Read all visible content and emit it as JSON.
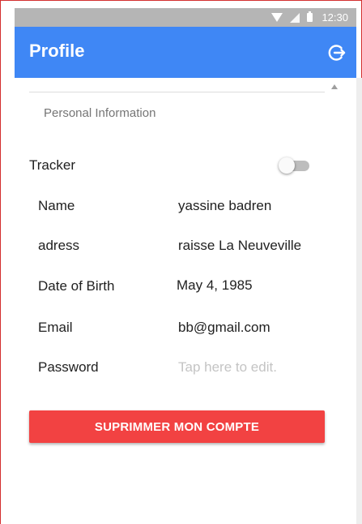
{
  "status_bar": {
    "time": "12:30"
  },
  "app_bar": {
    "title": "Profile"
  },
  "section": {
    "title": "Personal Information"
  },
  "tracker": {
    "label": "Tracker",
    "enabled": false
  },
  "fields": [
    {
      "label": "Name",
      "value": "yassine badren",
      "is_placeholder": false
    },
    {
      "label": "adress",
      "value": "raisse La Neuveville",
      "is_placeholder": false
    },
    {
      "label": "Date of Birth",
      "value": "May 4, 1985",
      "is_placeholder": false
    },
    {
      "label": "Email",
      "value": "bb@gmail.com",
      "is_placeholder": false
    },
    {
      "label": "Password",
      "value": "Tap here to edit.",
      "is_placeholder": true
    }
  ],
  "delete_button": {
    "label": "SUPRIMMER MON COMPTE"
  },
  "colors": {
    "app_bar": "#3f87f5",
    "delete_button": "#f24242",
    "status_bar": "#b5b5b5"
  }
}
